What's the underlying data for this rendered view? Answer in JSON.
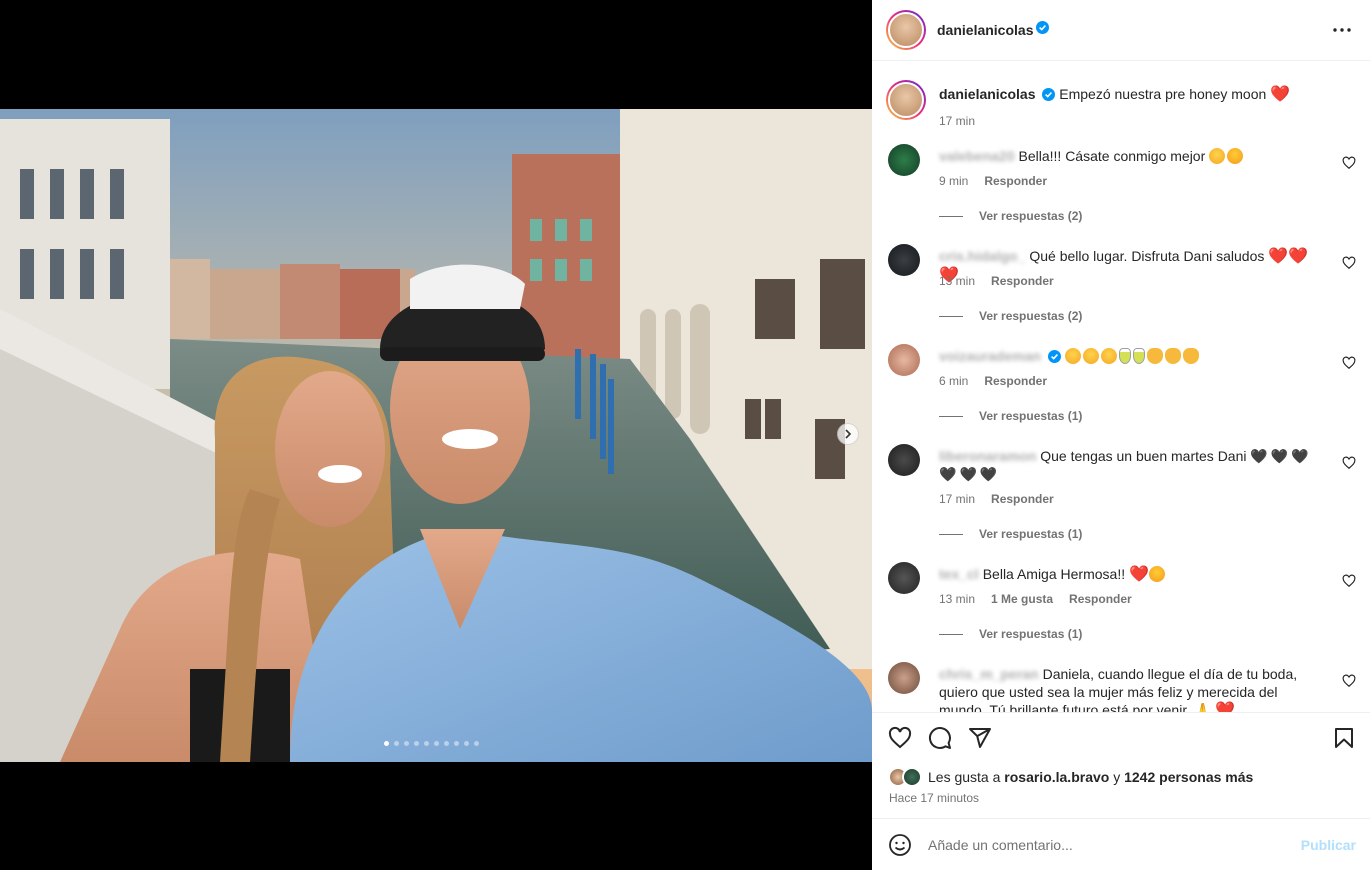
{
  "post": {
    "username": "danielanicolas",
    "caption": "Empezó nuestra pre honey moon",
    "caption_time": "17 min",
    "carousel_dots": 10,
    "active_dot": 0
  },
  "comments": [
    {
      "user": "valebena20",
      "text": "Bella!!! Cásate conmigo mejor",
      "emojis": [
        "e-laugh",
        "e-hearteyes"
      ],
      "time": "9 min",
      "likes": "",
      "reply": "Responder",
      "replies": "Ver respuestas (2)"
    },
    {
      "user": "cris.hidalgo_",
      "text": "Qué bello lugar. Disfruta Dani saludos",
      "hearts": 3,
      "time": "13 min",
      "likes": "",
      "reply": "Responder",
      "replies": "Ver respuestas (2)"
    },
    {
      "user": "voizaurademan",
      "text": "",
      "time": "6 min",
      "likes": "",
      "reply": "Responder",
      "replies": "Ver respuestas (1)"
    },
    {
      "user": "liberonaramon",
      "text": "Que tengas un buen martes Dani",
      "time": "17 min",
      "likes": "",
      "reply": "Responder",
      "replies": "Ver respuestas (1)"
    },
    {
      "user": "tex_cl",
      "text": "Bella Amiga Hermosa!!",
      "time": "13 min",
      "likes": "1 Me gusta",
      "reply": "Responder",
      "replies": "Ver respuestas (1)"
    },
    {
      "user": "chris_m_peran",
      "text": "Daniela, cuando llegue el día de tu boda, quiero que usted sea la mujer más feliz y merecida del mundo. Tú brillante futuro está por venir. 🙏",
      "time": "",
      "likes": "",
      "reply": "",
      "replies": ""
    }
  ],
  "likes": {
    "prefix": "Les gusta a",
    "user": "rosario.la.bravo",
    "joiner": "y",
    "others": "1242 personas más",
    "time": "Hace 17 minutos"
  },
  "comment_box": {
    "placeholder": "Añade un comentario...",
    "publish_label": "Publicar"
  },
  "icons": {
    "more": "more-horizontal-icon",
    "like": "heart-icon",
    "comment": "comment-icon",
    "share": "send-icon",
    "save": "bookmark-icon",
    "emoji": "emoji-icon"
  },
  "colors": {
    "verified": "#0095f6",
    "publish_disabled": "#b2dffc",
    "red_heart": "#e0245e"
  }
}
